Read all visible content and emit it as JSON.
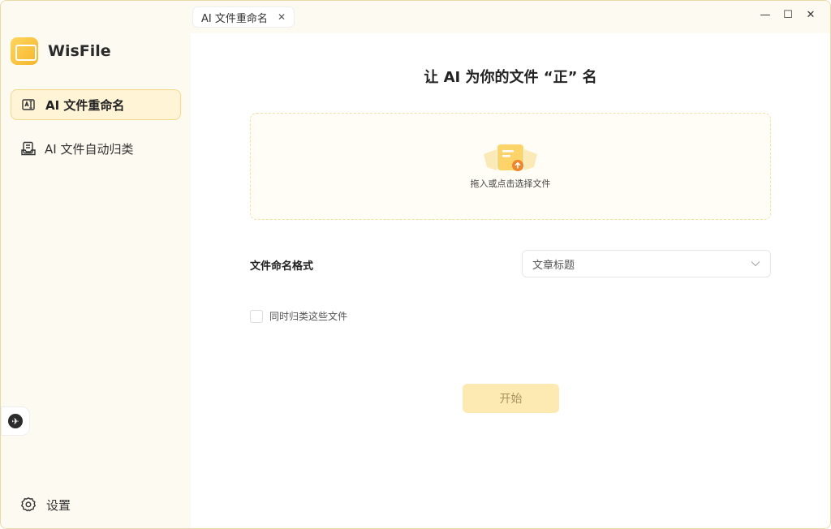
{
  "app": {
    "name": "WisFile"
  },
  "tab": {
    "label": "AI 文件重命名",
    "close": "✕"
  },
  "window_controls": {
    "minimize": "—",
    "maximize": "☐",
    "close": "✕"
  },
  "sidebar": {
    "items": [
      {
        "label": "AI 文件重命名",
        "icon": "rename-icon",
        "active": true
      },
      {
        "label": "AI 文件自动归类",
        "icon": "classify-icon",
        "active": false
      }
    ],
    "settings_label": "设置"
  },
  "main": {
    "title": "让 AI 为你的文件 “正” 名",
    "dropzone_text": "拖入或点击选择文件",
    "naming_format_label": "文件命名格式",
    "naming_format_value": "文章标题",
    "checkbox_label": "同时归类这些文件",
    "start_button": "开始"
  },
  "colors": {
    "accent": "#f5b52c",
    "start_button_bg": "#fdeab3",
    "active_item_bg": "#fff4d6"
  }
}
